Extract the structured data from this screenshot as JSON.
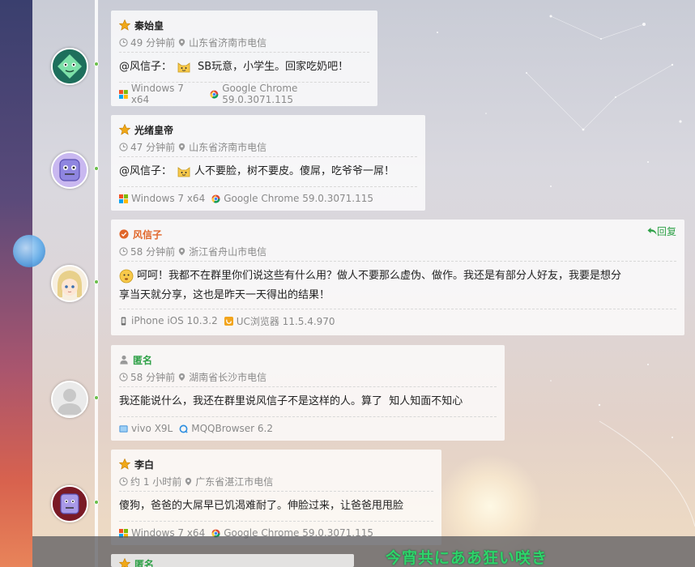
{
  "comments": [
    {
      "name": "秦始皇",
      "role": "star",
      "time": "49 分钟前",
      "location": "山东省济南市电信",
      "mention": "@风信子：",
      "text": "SB玩意，小学生。回家吃奶吧！",
      "os": "Windows 7 x64",
      "browser": "Google Chrome 59.0.3071.115",
      "avatar": "green-diamond"
    },
    {
      "name": "光绪皇帝",
      "role": "star",
      "time": "47 分钟前",
      "location": "山东省济南市电信",
      "mention": "@风信子：",
      "text": "人不要脸，树不要皮。傻屌，吃爷爷一屌！",
      "os": "Windows 7 x64",
      "browser": "Google Chrome 59.0.3071.115",
      "avatar": "purple-face"
    },
    {
      "name": "风信子",
      "role": "admin",
      "reply_label": "回复",
      "time": "58 分钟前",
      "location": "浙江省舟山市电信",
      "text_line1": "呵呵！我都不在群里你们说这些有什么用？做人不要那么虚伪、做作。我还是有部分人好友，我要是想分",
      "text_line2": "享当天就分享，这也是昨天一天得出的结果！",
      "os": "iPhone iOS 10.3.2",
      "browser": "UC浏览器 11.5.4.970",
      "avatar": "anime-girl"
    },
    {
      "name": "匿名",
      "role": "anonymous",
      "time": "58 分钟前",
      "location": "湖南省长沙市电信",
      "text": "我还能说什么，我还在群里说风信子不是这样的人。算了  知人知面不知心",
      "os": "vivo X9L",
      "browser": "MQQBrowser 6.2",
      "avatar": "default-gray"
    },
    {
      "name": "李白",
      "role": "star",
      "time": "约 1 小时前",
      "location": "广东省湛江市电信",
      "text": "傻狗，爸爸的大屌早已饥渴难耐了。伸脸过来，让爸爸甩甩脸",
      "os": "Windows 7 x64",
      "browser": "Google Chrome 59.0.3071.115",
      "avatar": "purple-box"
    },
    {
      "name": "匿名",
      "role": "anonymous"
    }
  ],
  "footer": {
    "banner_text": "今宵共にああ狂い咲き"
  },
  "colors": {
    "timeline_dot": "#6bc04b",
    "reply": "#2fa148",
    "admin": "#e0662a",
    "anonymous": "#2fa148",
    "star_badge": "#f0a818"
  }
}
